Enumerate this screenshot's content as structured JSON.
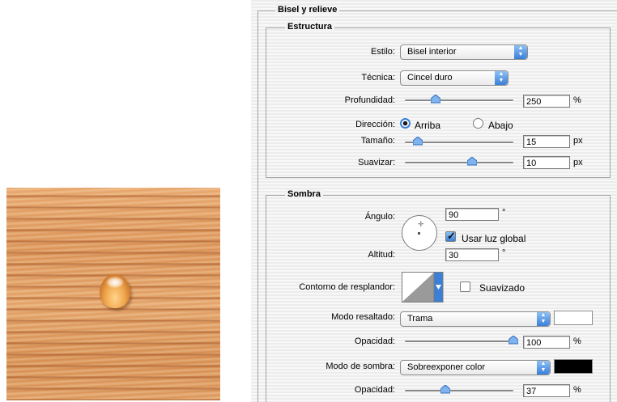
{
  "preview": {
    "description_colors": {
      "wood": "#dc975b",
      "drop": "#f0a64c"
    }
  },
  "bevel": {
    "title": "Bisel y relieve",
    "structure": {
      "title": "Estructura",
      "style_label": "Estilo:",
      "style_value": "Bisel interior",
      "technique_label": "Técnica:",
      "technique_value": "Cincel duro",
      "depth_label": "Profundidad:",
      "depth_value": "250",
      "depth_unit": "%",
      "depth_slider": 0.28,
      "direction_label": "Dirección:",
      "dir_up": "Arriba",
      "dir_down": "Abajo",
      "size_label": "Tamaño:",
      "size_value": "15",
      "size_unit": "px",
      "size_slider": 0.12,
      "soften_label": "Suavizar:",
      "soften_value": "10",
      "soften_unit": "px",
      "soften_slider": 0.62
    },
    "shading": {
      "title": "Sombra",
      "angle_label": "Ángulo:",
      "angle_value": "90",
      "angle_unit": "°",
      "global_light_label": "Usar luz global",
      "altitude_label": "Altitud:",
      "altitude_value": "30",
      "altitude_unit": "°",
      "gloss_label": "Contorno de resplandor:",
      "antialiased_label": "Suavizado",
      "highlight_mode_label": "Modo resaltado:",
      "highlight_mode_value": "Trama",
      "highlight_opacity_label": "Opacidad:",
      "highlight_opacity_value": "100",
      "highlight_opacity_unit": "%",
      "highlight_opacity_slider": 1.0,
      "highlight_color": "#ffffff",
      "shadow_mode_label": "Modo de sombra:",
      "shadow_mode_value": "Sobreexponer color",
      "shadow_opacity_label": "Opacidad:",
      "shadow_opacity_value": "37",
      "shadow_opacity_unit": "%",
      "shadow_opacity_slider": 0.37,
      "shadow_color": "#000000"
    }
  }
}
